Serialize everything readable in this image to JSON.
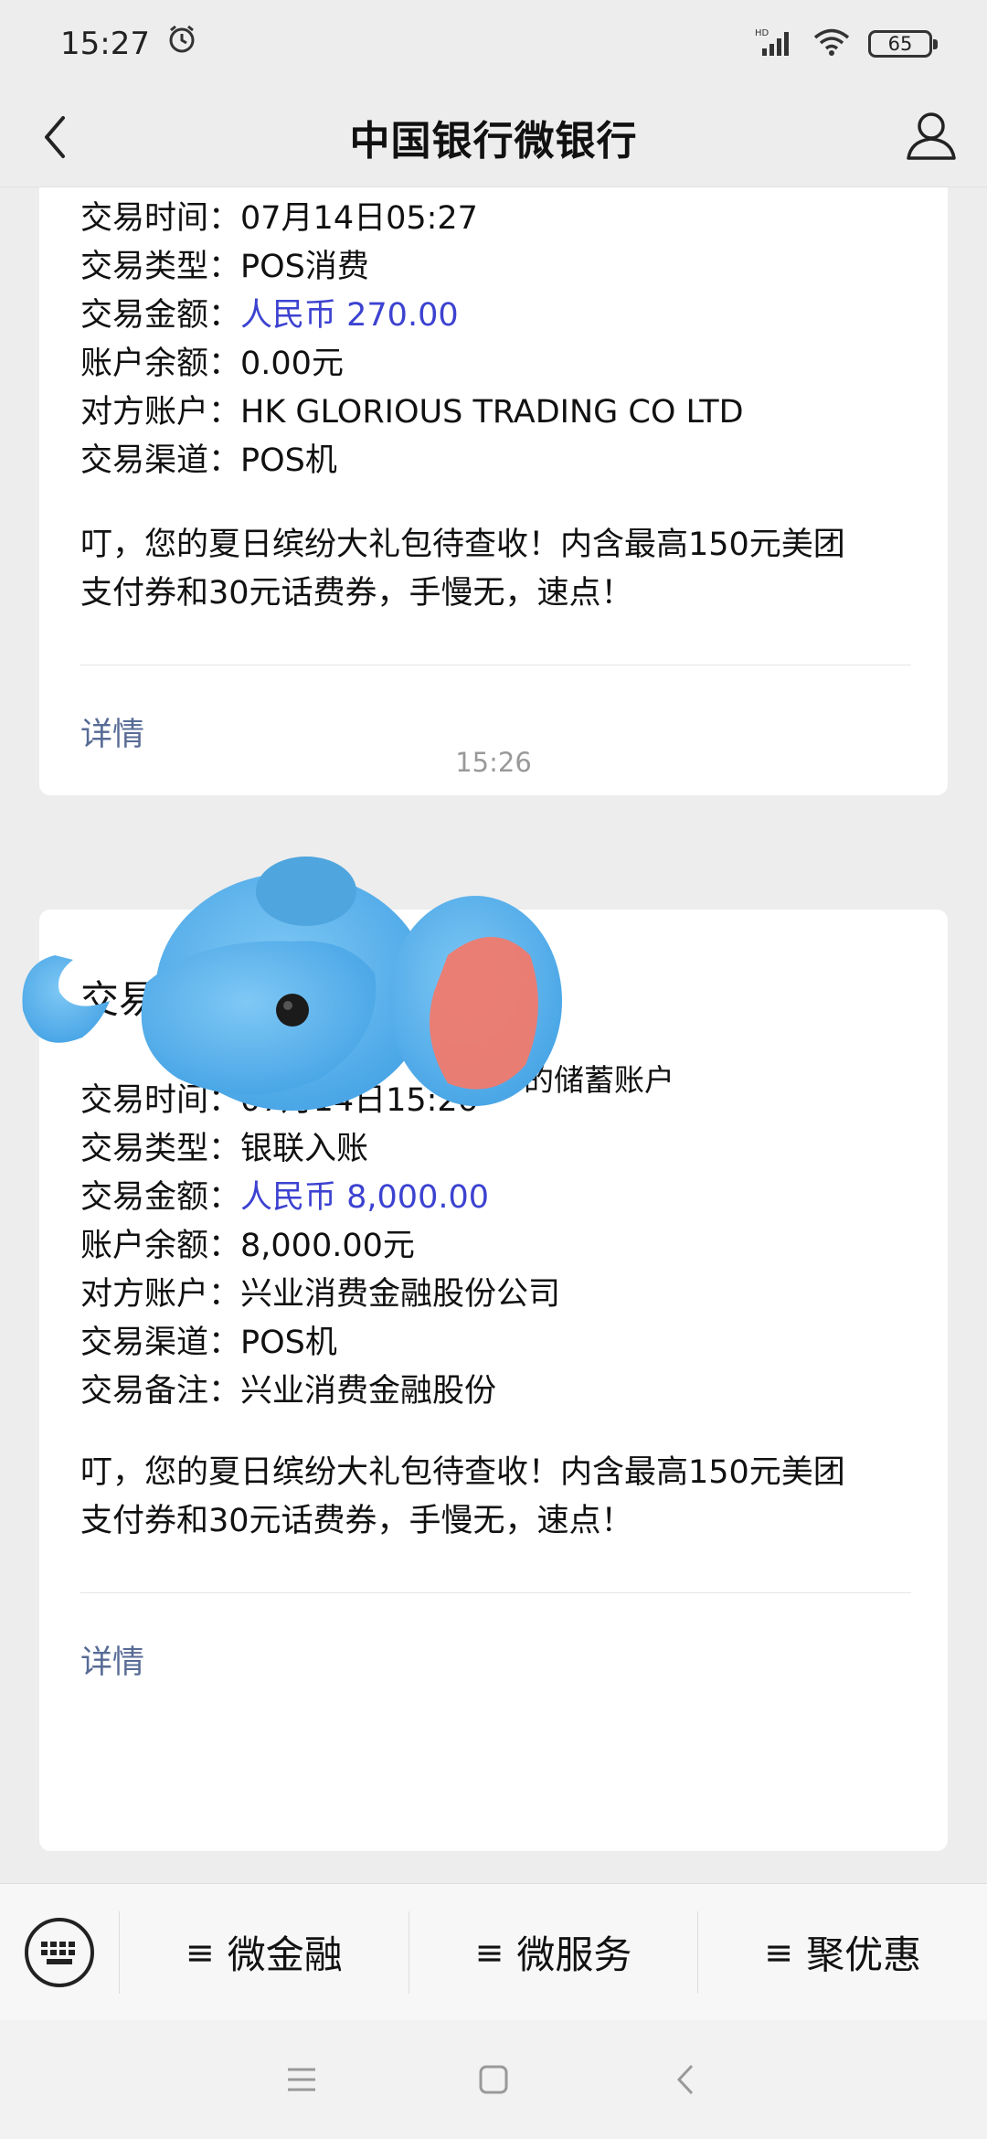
{
  "status_bar": {
    "time": "15:27",
    "battery": "65",
    "network": "HD"
  },
  "header": {
    "title": "中国银行微银行"
  },
  "card1": {
    "rows": [
      {
        "key": "交易时间：",
        "value": "07月14日05:27"
      },
      {
        "key": "交易类型：",
        "value": "POS消费"
      },
      {
        "key": "交易金额：",
        "value": "人民币 270.00"
      },
      {
        "key": "账户余额：",
        "value": "0.00元"
      },
      {
        "key": "对方账户：",
        "value": "HK GLORIOUS TRADING CO LTD"
      },
      {
        "key": "交易渠道：",
        "value": "POS机"
      }
    ],
    "promo_line1": "叮，您的夏日缤纷大礼包待查收！内含最高150元美团",
    "promo_line2": "支付券和30元话费券，手慢无，速点！",
    "detail": "详情"
  },
  "time_label": "15:26",
  "card2": {
    "title": "交易提",
    "subtitle": "的储蓄账户",
    "rows": [
      {
        "key": "交易时间：",
        "value": "07月14日15:26"
      },
      {
        "key": "交易类型：",
        "value": "银联入账"
      },
      {
        "key": "交易金额：",
        "value": "人民币 8,000.00"
      },
      {
        "key": "账户余额：",
        "value": "8,000.00元"
      },
      {
        "key": "对方账户：",
        "value": "兴业消费金融股份公司"
      },
      {
        "key": "交易渠道：",
        "value": "POS机"
      },
      {
        "key": "交易备注：",
        "value": "兴业消费金融股份"
      }
    ],
    "promo_line1": "叮，您的夏日缤纷大礼包待查收！内含最高150元美团",
    "promo_line2": "支付券和30元话费券，手慢无，速点！",
    "detail": "详情"
  },
  "menu": {
    "items": [
      {
        "label": "微金融"
      },
      {
        "label": "微服务"
      },
      {
        "label": "聚优惠"
      }
    ]
  },
  "colors": {
    "amount_blue": "#3c42d0",
    "link_blue": "#576b95",
    "sticker_blue": "#5db4ee",
    "sticker_ear": "#f07a6e"
  },
  "icons": [
    "alarm-icon",
    "signal-icon",
    "wifi-icon",
    "battery-icon",
    "back-icon",
    "user-icon",
    "keyboard-icon",
    "menu-icon",
    "home-icon",
    "nav-back-icon",
    "elephant-sticker"
  ]
}
